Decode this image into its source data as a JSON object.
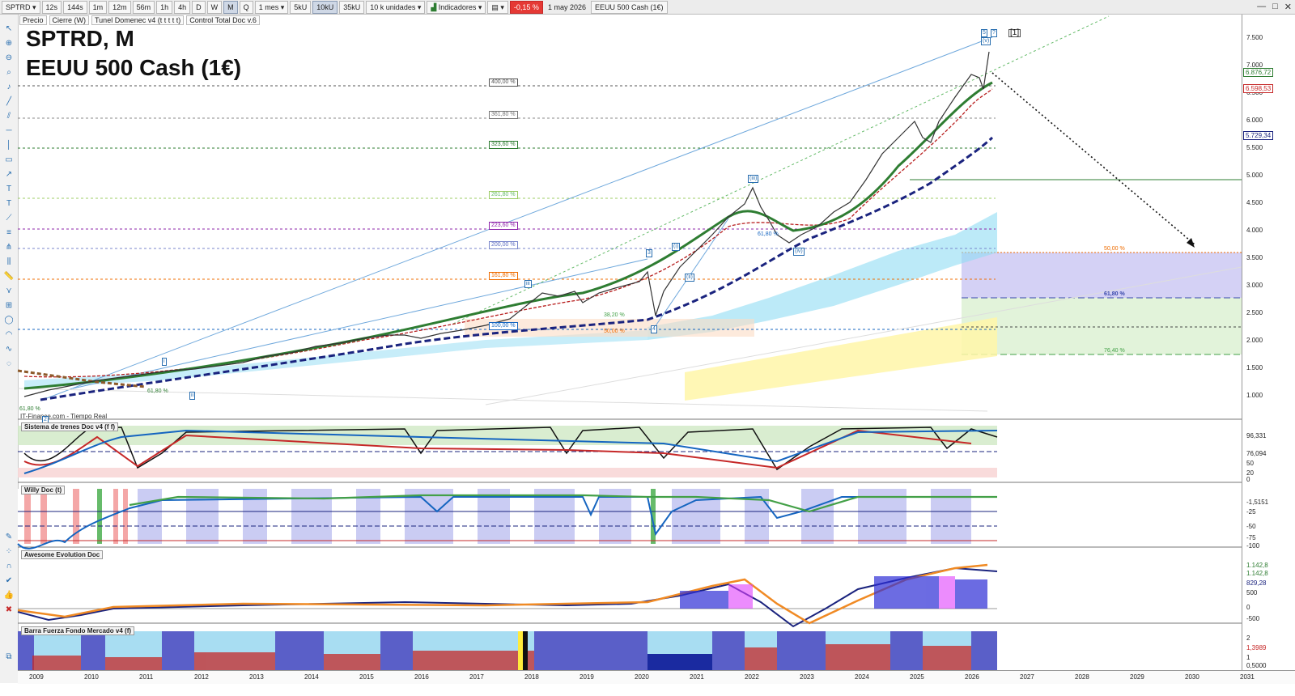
{
  "toolbar": {
    "symbol": "SPTRD",
    "timeframes": [
      "12s",
      "144s",
      "1m",
      "12m",
      "56m",
      "1h",
      "4h",
      "D",
      "W",
      "M",
      "Q"
    ],
    "active_timeframe": "M",
    "range": "1 mes",
    "units_buttons": [
      "5kU",
      "10kU",
      "35kU"
    ],
    "active_unit": "10kU",
    "units_select": "10 k unidades",
    "indicators_label": "Indicadores",
    "change_pct": "-0,15 %",
    "date": "1 may 2026",
    "instrument": "EEUU 500 Cash (1€)"
  },
  "legend": [
    "Precio",
    "Cierre (W)",
    "Tunel Domenec v4 (t t t t t)",
    "Control Total Doc v.6"
  ],
  "chart_title": {
    "line1": "SPTRD, M",
    "line2": "EEUU 500 Cash (1€)"
  },
  "source_label": "IT-Finance.com - Tiempo Real",
  "panels": {
    "p1": "Sistema de trenes Doc v4 (f f)",
    "p2": "Willy Doc (t)",
    "p3": "Awesome Evolution Doc",
    "p4": "Barra Fuerza Fondo Mercado v4 (f)"
  },
  "price_axis": [
    "7.500",
    "7.000",
    "6.500",
    "6.000",
    "5.500",
    "5.000",
    "4.500",
    "4.000",
    "3.500",
    "3.000",
    "2.500",
    "2.000",
    "1.500",
    "1.000"
  ],
  "price_tags": [
    {
      "text": "6.876,72",
      "color": "#2e7d32"
    },
    {
      "text": "6.598,53",
      "color": "#c62828"
    },
    {
      "text": "5.729,34",
      "color": "#1a237e"
    }
  ],
  "fib_levels": [
    {
      "text": "400,00 %",
      "color": "#555"
    },
    {
      "text": "361,80 %",
      "color": "#777"
    },
    {
      "text": "323,60 %",
      "color": "#2e7d32"
    },
    {
      "text": "261,80 %",
      "color": "#66bb6a"
    },
    {
      "text": "223,60 %",
      "color": "#8e24aa"
    },
    {
      "text": "200,00 %",
      "color": "#5c6bc0"
    },
    {
      "text": "161,80 %",
      "color": "#ef6c00"
    },
    {
      "text": "100,00 %",
      "color": "#1565c0"
    }
  ],
  "retracement_levels": [
    {
      "text": "50,00 %",
      "color": "#ef6c00"
    },
    {
      "text": "61,80 %",
      "color": "#3949ab"
    },
    {
      "text": "76,40 %",
      "color": "#43a047"
    }
  ],
  "minor_labels": {
    "fib_382": "38,20 %",
    "fib_50": "50,00 %",
    "fib_618a": "61,80 %",
    "fib_618b": "61,80 %",
    "fib_618c": "61,80 %"
  },
  "wave_labels": {
    "w1": "[1]",
    "w5": "5",
    "wv": "(v)",
    "wiii": "(iii)",
    "wi": "(i)",
    "wii": "(ii)",
    "wiv": "(iv)",
    "wa": "i",
    "wb": "ii",
    "wc": "iii",
    "w3": "3",
    "w4": "4",
    "w2": "2",
    "wq": "?"
  },
  "indicator_axes": {
    "p1": [
      "96,331",
      "76,094",
      "50",
      "20",
      "0"
    ],
    "p2": [
      "-1,5151",
      "-25",
      "-50",
      "-75",
      "-100"
    ],
    "p3": [
      "1.142,8",
      "1.142,8",
      "829,28",
      "500",
      "0",
      "-500"
    ],
    "p4": [
      "2",
      "1,3989",
      "1",
      "0,5000"
    ]
  },
  "years": [
    "2009",
    "2010",
    "2011",
    "2012",
    "2013",
    "2014",
    "2015",
    "2016",
    "2017",
    "2018",
    "2019",
    "2020",
    "2021",
    "2022",
    "2023",
    "2024",
    "2025",
    "2026",
    "2027",
    "2028",
    "2029",
    "2030",
    "2031"
  ],
  "colors": {
    "bull": "#2e7d32",
    "bear": "#c62828",
    "trend": "#1a237e",
    "accent": "#2a6fb0"
  }
}
